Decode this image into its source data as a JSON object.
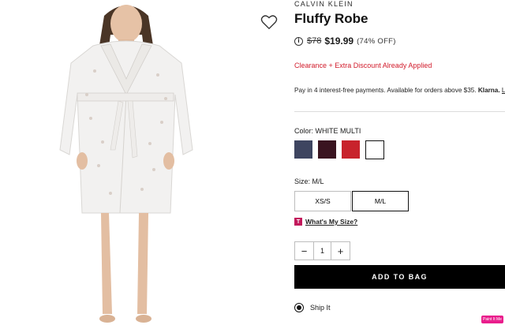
{
  "product": {
    "brand": "CALVIN KLEIN",
    "title": "Fluffy Robe",
    "original_price": "$78",
    "sale_price": "$19.99",
    "discount": "(74% OFF)",
    "promo": "Clearance + Extra Discount Already Applied",
    "pay_text": "Pay in 4 interest-free payments. Available for orders above $35.",
    "pay_brand": "Klarna.",
    "pay_link": "L"
  },
  "color": {
    "label": "Color:",
    "selected": "WHITE MULTI",
    "swatches": [
      {
        "name": "navy",
        "hex": "#3e4560"
      },
      {
        "name": "burgundy",
        "hex": "#3a1420"
      },
      {
        "name": "red",
        "hex": "#c8232c"
      },
      {
        "name": "white",
        "hex": "#ffffff"
      }
    ]
  },
  "size": {
    "label": "Size:",
    "selected": "M/L",
    "options": [
      "XS/S",
      "M/L"
    ],
    "guide_icon": "T",
    "guide_link": "What's My Size?"
  },
  "quantity": {
    "minus": "−",
    "value": "1",
    "plus": "+"
  },
  "actions": {
    "add_to_bag": "ADD TO BAG",
    "ship_option": "Ship It"
  },
  "badge": "Paint It Me",
  "colors": {
    "accent": "#000000",
    "promo": "#d11a2a",
    "badge": "#e91e8c"
  }
}
